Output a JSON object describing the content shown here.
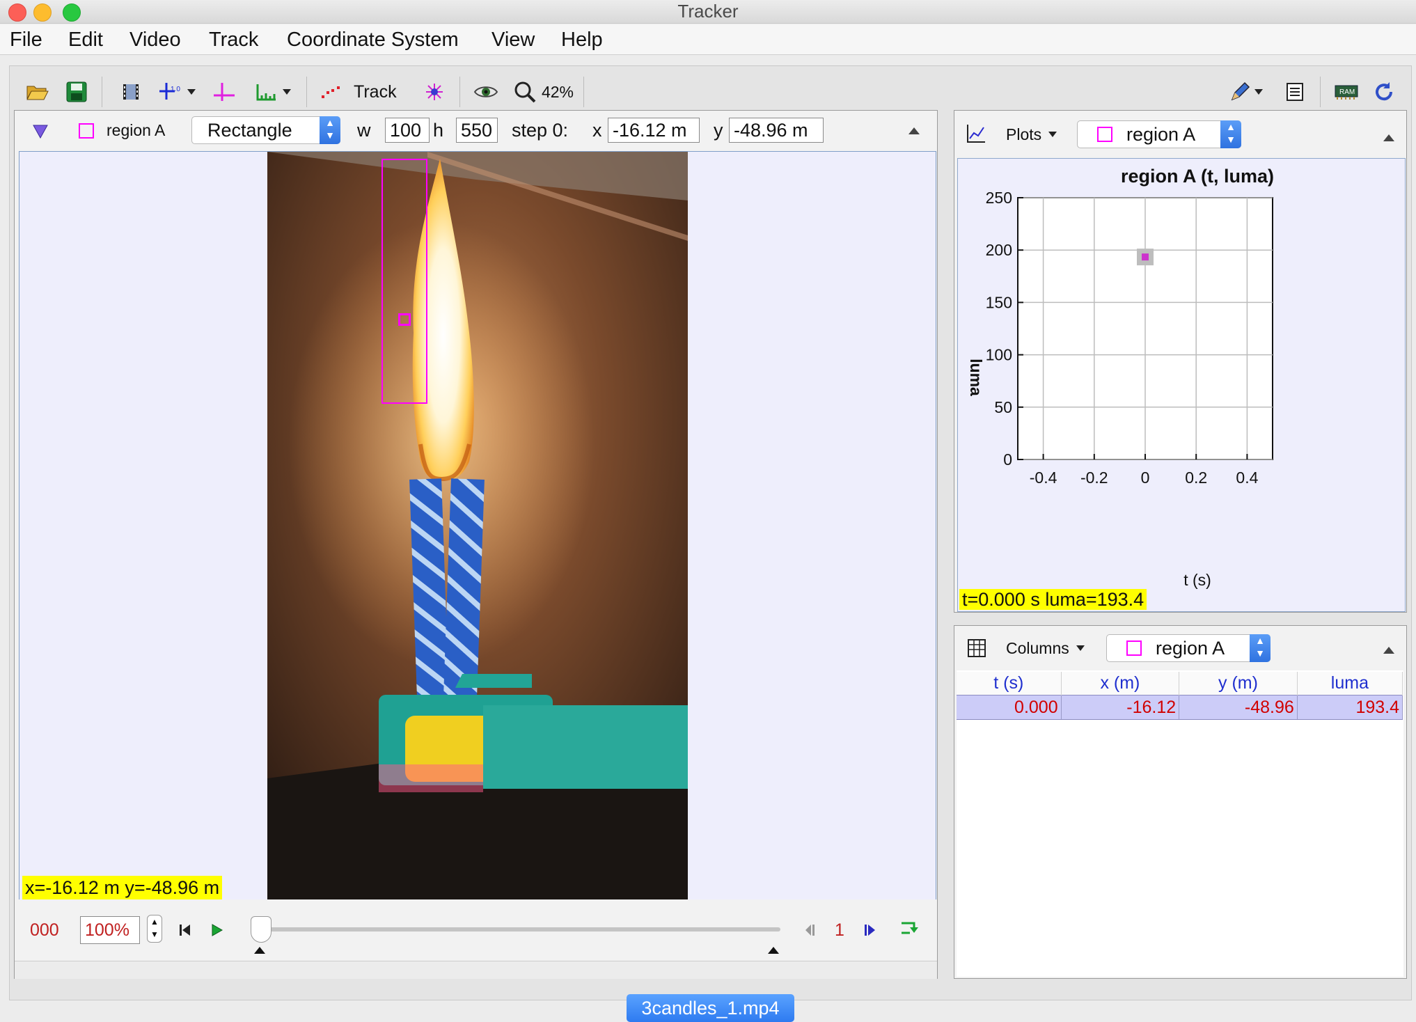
{
  "window": {
    "title": "Tracker"
  },
  "menu": [
    "File",
    "Edit",
    "Video",
    "Track",
    "Coordinate System",
    "View",
    "Help"
  ],
  "toolbar": {
    "track_label": "Track",
    "zoom": "42%"
  },
  "track_bar": {
    "track_name": "region A",
    "shape": "Rectangle",
    "w_label": "w",
    "w_value": "100",
    "h_label": "h",
    "h_value": "550",
    "step_label": "step 0:",
    "x_label": "x",
    "x_value": "-16.12 m",
    "y_label": "y",
    "y_value": "-48.96 m"
  },
  "viewport": {
    "readout": "x=-16.12 m  y=-48.96 m"
  },
  "player": {
    "frame_counter": "000",
    "rate": "100%",
    "step_size": "1",
    "slider_position": 0
  },
  "plot": {
    "menu_label": "Plots",
    "track_select": "region A",
    "readout": "t=0.000 s  luma=193.4",
    "chart_data": {
      "type": "scatter",
      "title": "region A (t, luma)",
      "xlabel": "t (s)",
      "ylabel": "luma",
      "xlim": [
        -0.5,
        0.5
      ],
      "ylim": [
        0,
        250
      ],
      "xticks": [
        "-0.4",
        "-0.2",
        "0",
        "0.2",
        "0.4"
      ],
      "xtick_values": [
        -0.4,
        -0.2,
        0,
        0.2,
        0.4
      ],
      "yticks": [
        "0",
        "50",
        "100",
        "150",
        "200",
        "250"
      ],
      "ytick_values": [
        0,
        50,
        100,
        150,
        200,
        250
      ],
      "grid": true,
      "points": [
        {
          "x": 0.0,
          "y": 193.4
        }
      ],
      "point_color": "#cc33cc"
    }
  },
  "table": {
    "menu_label": "Columns",
    "track_select": "region A",
    "headers": [
      "t (s)",
      "x (m)",
      "y (m)",
      "luma"
    ],
    "rows": [
      [
        "0.000",
        "-16.12",
        "-48.96",
        "193.4"
      ]
    ]
  },
  "tab": {
    "label": "3candles_1.mp4"
  },
  "colors": {
    "region": "#ff00ff",
    "readout_bg": "#ffff00",
    "table_value": "#d10000",
    "table_header": "#1f2fcf",
    "tab_bg": "#2e7bf0"
  }
}
